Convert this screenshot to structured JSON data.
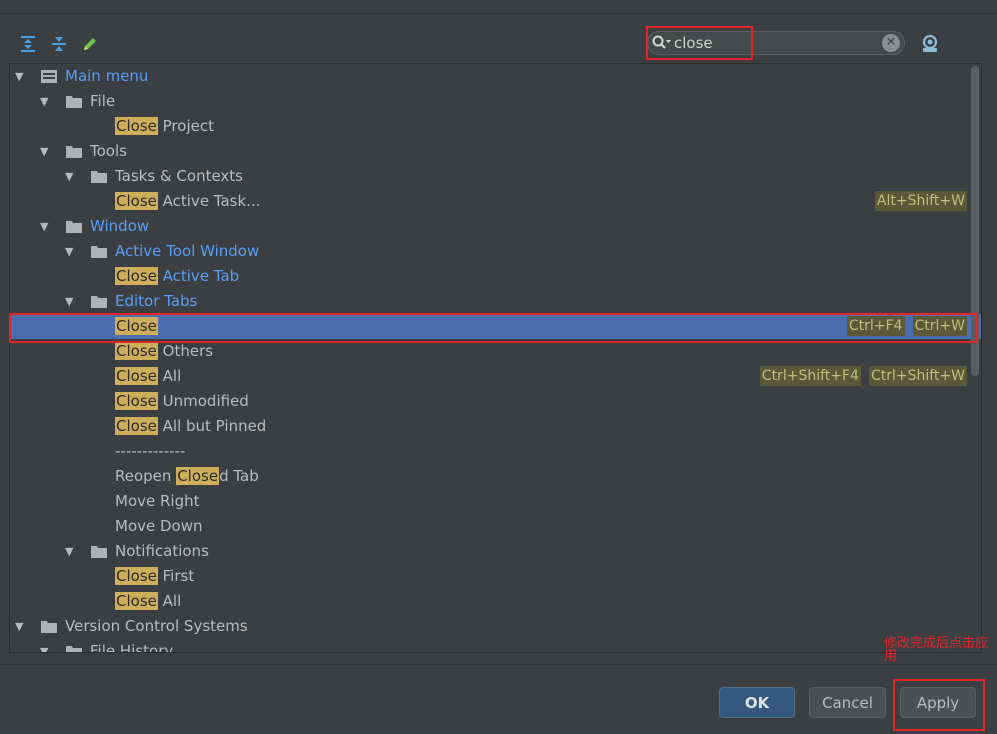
{
  "search": {
    "value": "close"
  },
  "tree": [
    {
      "depth": 0,
      "arrow": true,
      "icon": "menu",
      "parts": [
        {
          "t": "Main menu"
        }
      ],
      "blue": true
    },
    {
      "depth": 1,
      "arrow": true,
      "icon": "folder",
      "parts": [
        {
          "t": "File"
        }
      ]
    },
    {
      "depth": 3,
      "parts": [
        {
          "t": "Close",
          "hl": true
        },
        {
          "t": " Project"
        }
      ]
    },
    {
      "depth": 1,
      "arrow": true,
      "icon": "folder",
      "parts": [
        {
          "t": "Tools"
        }
      ]
    },
    {
      "depth": 2,
      "arrow": true,
      "icon": "folder",
      "parts": [
        {
          "t": "Tasks & Contexts"
        }
      ]
    },
    {
      "depth": 3,
      "parts": [
        {
          "t": "Close",
          "hl": true
        },
        {
          "t": " Active Task..."
        }
      ],
      "shortcuts": [
        "Alt+Shift+W"
      ]
    },
    {
      "depth": 1,
      "arrow": true,
      "icon": "folder",
      "parts": [
        {
          "t": "Window"
        }
      ],
      "blue": true
    },
    {
      "depth": 2,
      "arrow": true,
      "icon": "folder",
      "parts": [
        {
          "t": "Active Tool Window"
        }
      ],
      "blue": true
    },
    {
      "depth": 3,
      "parts": [
        {
          "t": "Close",
          "hl": true
        },
        {
          "t": " Active Tab"
        }
      ],
      "blue": true
    },
    {
      "depth": 2,
      "arrow": true,
      "icon": "folder",
      "parts": [
        {
          "t": "Editor Tabs"
        }
      ],
      "blue": true
    },
    {
      "depth": 3,
      "parts": [
        {
          "t": "Close",
          "hl": true
        }
      ],
      "selected": true,
      "shortcuts": [
        "Ctrl+F4",
        "Ctrl+W"
      ]
    },
    {
      "depth": 3,
      "parts": [
        {
          "t": "Close",
          "hl": true
        },
        {
          "t": " Others"
        }
      ]
    },
    {
      "depth": 3,
      "parts": [
        {
          "t": "Close",
          "hl": true
        },
        {
          "t": " All"
        }
      ],
      "shortcuts": [
        "Ctrl+Shift+F4",
        "Ctrl+Shift+W"
      ]
    },
    {
      "depth": 3,
      "parts": [
        {
          "t": "Close",
          "hl": true
        },
        {
          "t": " Unmodified"
        }
      ]
    },
    {
      "depth": 3,
      "parts": [
        {
          "t": "Close",
          "hl": true
        },
        {
          "t": " All but Pinned"
        }
      ]
    },
    {
      "depth": 3,
      "parts": [
        {
          "t": "-------------"
        }
      ]
    },
    {
      "depth": 3,
      "parts": [
        {
          "t": "Reopen "
        },
        {
          "t": "Close",
          "hl": true
        },
        {
          "t": "d Tab"
        }
      ]
    },
    {
      "depth": 3,
      "parts": [
        {
          "t": "Move Right"
        }
      ]
    },
    {
      "depth": 3,
      "parts": [
        {
          "t": "Move Down"
        }
      ]
    },
    {
      "depth": 2,
      "arrow": true,
      "icon": "folder",
      "parts": [
        {
          "t": "Notifications"
        }
      ]
    },
    {
      "depth": 3,
      "parts": [
        {
          "t": "Close",
          "hl": true
        },
        {
          "t": " First"
        }
      ]
    },
    {
      "depth": 3,
      "parts": [
        {
          "t": "Close",
          "hl": true
        },
        {
          "t": " All"
        }
      ]
    },
    {
      "depth": 0,
      "arrow": true,
      "icon": "folder",
      "parts": [
        {
          "t": "Version Control Systems"
        }
      ]
    },
    {
      "depth": 1,
      "arrow": true,
      "icon": "folder",
      "parts": [
        {
          "t": "File History"
        }
      ]
    }
  ],
  "buttons": {
    "ok": "OK",
    "cancel": "Cancel",
    "apply": "Apply"
  },
  "annotation": "修改完成后点击应用"
}
